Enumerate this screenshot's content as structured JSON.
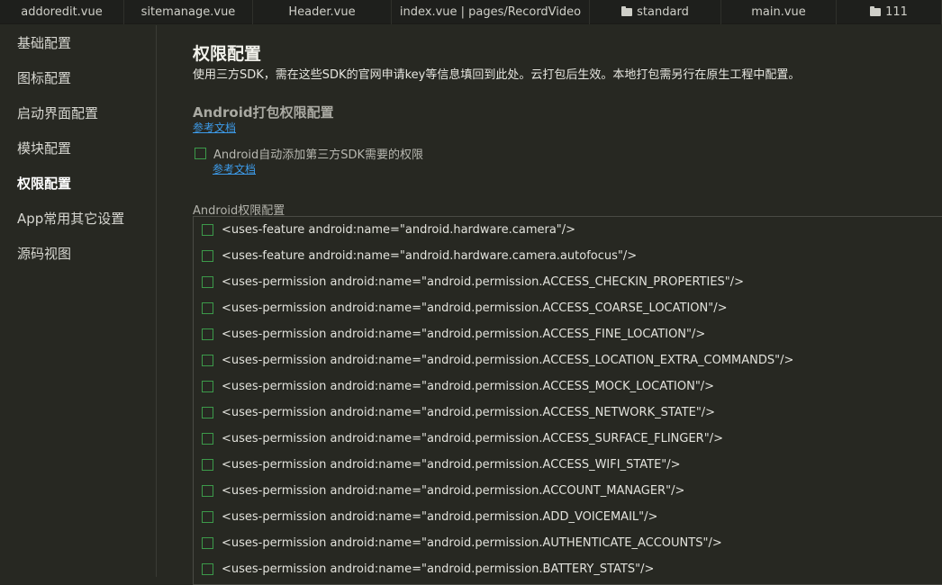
{
  "tabs": [
    {
      "label": "addoredit.vue",
      "folder": false
    },
    {
      "label": "sitemanage.vue",
      "folder": false
    },
    {
      "label": "Header.vue",
      "folder": false
    },
    {
      "label": "index.vue | pages/RecordVideo",
      "folder": false
    },
    {
      "label": "standard",
      "folder": true
    },
    {
      "label": "main.vue",
      "folder": false
    },
    {
      "label": "111",
      "folder": true
    }
  ],
  "sidebar": {
    "items": [
      {
        "label": "基础配置",
        "active": false
      },
      {
        "label": "图标配置",
        "active": false
      },
      {
        "label": "启动界面配置",
        "active": false
      },
      {
        "label": "模块配置",
        "active": false
      },
      {
        "label": "权限配置",
        "active": true
      },
      {
        "label": "App常用其它设置",
        "active": false
      },
      {
        "label": "源码视图",
        "active": false
      }
    ]
  },
  "main": {
    "title": "权限配置",
    "description": "使用三方SDK，需在这些SDK的官网申请key等信息填回到此处。云打包后生效。本地打包需另行在原生工程中配置。",
    "android_section_title": "Android打包权限配置",
    "doc_link_1": "参考文档",
    "auto_add_label": "Android自动添加第三方SDK需要的权限",
    "auto_add_checked": false,
    "doc_link_2": "参考文档",
    "permissions_label": "Android权限配置",
    "permissions": [
      "<uses-feature android:name=\"android.hardware.camera\"/>",
      "<uses-feature android:name=\"android.hardware.camera.autofocus\"/>",
      "<uses-permission android:name=\"android.permission.ACCESS_CHECKIN_PROPERTIES\"/>",
      "<uses-permission android:name=\"android.permission.ACCESS_COARSE_LOCATION\"/>",
      "<uses-permission android:name=\"android.permission.ACCESS_FINE_LOCATION\"/>",
      "<uses-permission android:name=\"android.permission.ACCESS_LOCATION_EXTRA_COMMANDS\"/>",
      "<uses-permission android:name=\"android.permission.ACCESS_MOCK_LOCATION\"/>",
      "<uses-permission android:name=\"android.permission.ACCESS_NETWORK_STATE\"/>",
      "<uses-permission android:name=\"android.permission.ACCESS_SURFACE_FLINGER\"/>",
      "<uses-permission android:name=\"android.permission.ACCESS_WIFI_STATE\"/>",
      "<uses-permission android:name=\"android.permission.ACCOUNT_MANAGER\"/>",
      "<uses-permission android:name=\"android.permission.ADD_VOICEMAIL\"/>",
      "<uses-permission android:name=\"android.permission.AUTHENTICATE_ACCOUNTS\"/>",
      "<uses-permission android:name=\"android.permission.BATTERY_STATS\"/>"
    ]
  },
  "colors": {
    "background": "#272822",
    "tabbar": "#1e1f1c",
    "link": "#3d9be9",
    "checkbox_border": "#3c9a4a"
  }
}
